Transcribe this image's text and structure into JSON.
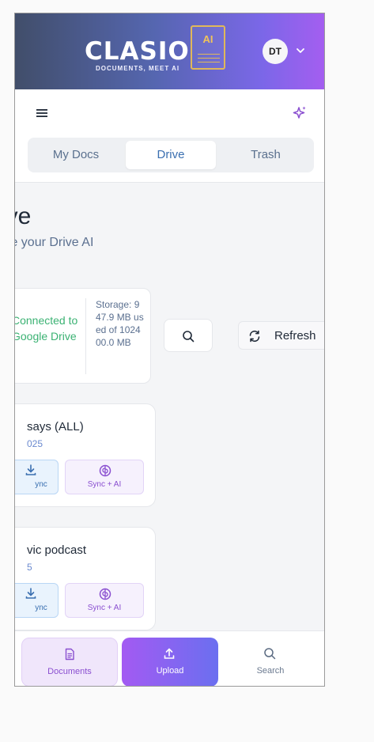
{
  "header": {
    "logo_word": "CLASIO",
    "logo_badge": "AI",
    "tagline": "DOCUMENTS, MEET AI",
    "avatar_initials": "DT"
  },
  "tabs": [
    {
      "label": "My Docs",
      "active": false
    },
    {
      "label": "Drive",
      "active": true
    },
    {
      "label": "Trash",
      "active": false
    }
  ],
  "page": {
    "title": "rive",
    "subtitle": "nize your Drive AI"
  },
  "status": {
    "connection": "Connected to Google Drive",
    "storage": "Storage: 947.9 MB used of 102400.0 MB"
  },
  "actions": {
    "refresh_label": "Refresh"
  },
  "documents": [
    {
      "title": "says (ALL)",
      "date": "025",
      "sync_label": "ync",
      "sync_ai_label": "Sync + AI"
    },
    {
      "title": "vic podcast",
      "date": "5",
      "sync_label": "ync",
      "sync_ai_label": "Sync + AI"
    }
  ],
  "bottom_nav": [
    {
      "label": "Documents",
      "icon": "document-icon",
      "active": true
    },
    {
      "label": "Upload",
      "icon": "upload-icon",
      "active": false
    },
    {
      "label": "Search",
      "icon": "search-icon",
      "active": false
    }
  ],
  "colors": {
    "header_gradient_start": "#414e6a",
    "header_gradient_end": "#a45ef0",
    "accent_purple": "#8a4fd0",
    "accent_blue": "#3a6fb0",
    "connected_green": "#3bb273"
  }
}
